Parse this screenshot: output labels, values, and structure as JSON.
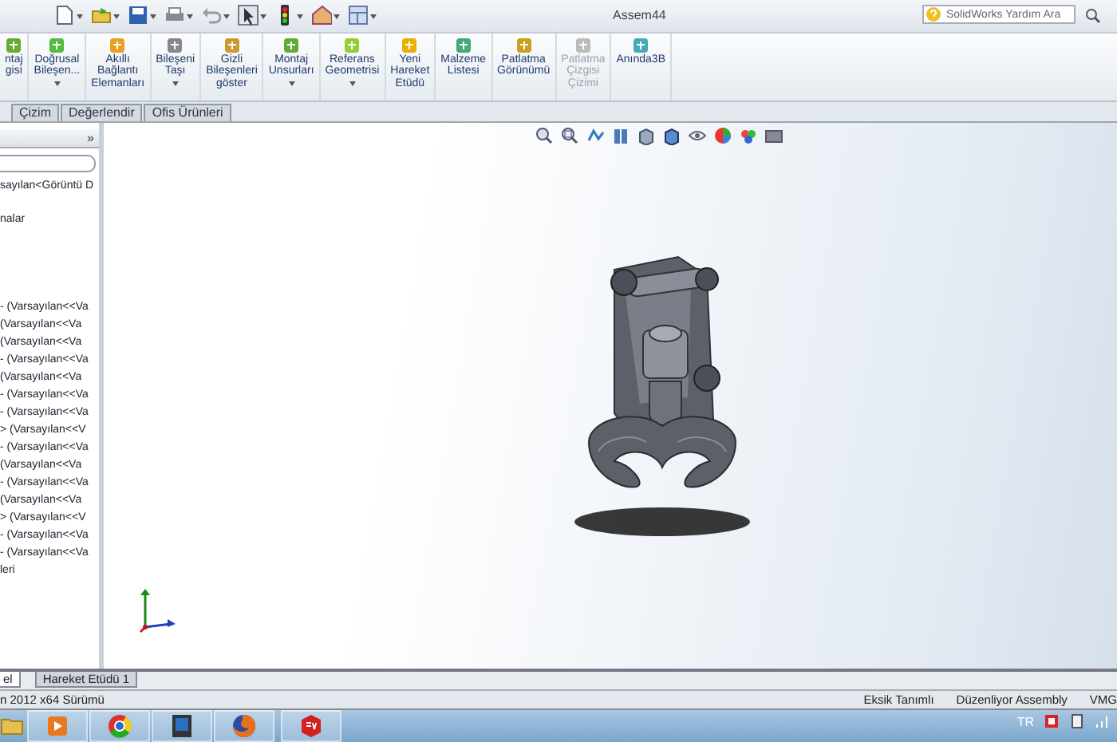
{
  "window": {
    "title": "Assem44",
    "search": {
      "placeholder": "SolidWorks Yardım Ara"
    }
  },
  "ribbon": {
    "buttons": [
      {
        "label": "ntaj\ngisi",
        "dropdown": false,
        "disabled": false
      },
      {
        "label": "Doğrusal\nBileşen...",
        "dropdown": true,
        "disabled": false
      },
      {
        "label": "Akıllı\nBağlantı\nElemanları",
        "dropdown": false,
        "disabled": false
      },
      {
        "label": "Bileşeni\nTaşı",
        "dropdown": true,
        "disabled": false
      },
      {
        "label": "Gizli\nBileşenleri\ngöster",
        "dropdown": false,
        "disabled": false
      },
      {
        "label": "Montaj\nUnsurları",
        "dropdown": true,
        "disabled": false
      },
      {
        "label": "Referans\nGeometrisi",
        "dropdown": true,
        "disabled": false
      },
      {
        "label": "Yeni\nHareket\nEtüdü",
        "dropdown": false,
        "disabled": false
      },
      {
        "label": "Malzeme\nListesi",
        "dropdown": false,
        "disabled": false
      },
      {
        "label": "Patlatma\nGörünümü",
        "dropdown": false,
        "disabled": false
      },
      {
        "label": "Patlatma\nÇizgisi\nÇizimi",
        "dropdown": false,
        "disabled": true
      },
      {
        "label": "Anında3B",
        "dropdown": false,
        "disabled": false
      }
    ]
  },
  "tabs": [
    {
      "label": "Çizim",
      "selected": false
    },
    {
      "label": "Değerlendir",
      "selected": false
    },
    {
      "label": "Ofis Ürünleri",
      "selected": false
    }
  ],
  "tree": {
    "collapse": "»",
    "items": [
      "sayılan<Görüntü D",
      "nalar",
      "- (Varsayılan<<Va",
      "(Varsayılan<<Va",
      "(Varsayılan<<Va",
      "- (Varsayılan<<Va",
      "(Varsayılan<<Va",
      "- (Varsayılan<<Va",
      "- (Varsayılan<<Va",
      "> (Varsayılan<<V",
      "- (Varsayılan<<Va",
      "(Varsayılan<<Va",
      "- (Varsayılan<<Va",
      "(Varsayılan<<Va",
      "> (Varsayılan<<V",
      "- (Varsayılan<<Va",
      "- (Varsayılan<<Va",
      "leri"
    ]
  },
  "bottom_tabs": [
    {
      "label": "el",
      "selected": true
    },
    {
      "label": "Hareket Etüdü 1",
      "selected": false
    }
  ],
  "status_bar": {
    "version": "n 2012 x64 Sürümü",
    "fields": [
      "Eksik Tanımlı",
      "Düzenliyor Assembly",
      "VMG"
    ]
  },
  "taskbar": {
    "language": "TR"
  }
}
